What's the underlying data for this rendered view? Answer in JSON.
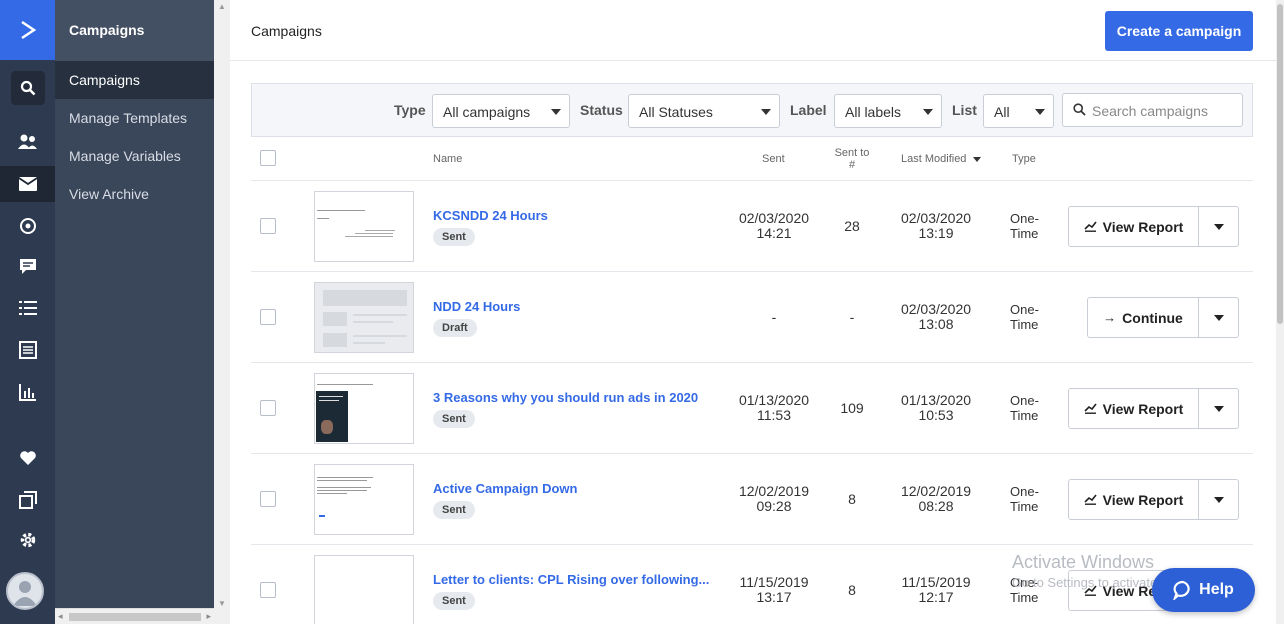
{
  "colors": {
    "accent": "#356ae6",
    "rail": "#2d3a50",
    "subnav": "#3a4659"
  },
  "sidebar": {
    "icons": [
      "logo-chevron-icon",
      "search-icon",
      "contacts-icon",
      "campaigns-envelope-icon",
      "automations-icon",
      "conversations-icon",
      "lists-icon",
      "forms-icon",
      "reports-icon",
      "apps-heart-icon",
      "pages-icon",
      "settings-gear-icon",
      "user-avatar"
    ]
  },
  "subnav": {
    "title": "Campaigns",
    "items": [
      {
        "label": "Campaigns"
      },
      {
        "label": "Manage Templates"
      },
      {
        "label": "Manage Variables"
      },
      {
        "label": "View Archive"
      }
    ]
  },
  "header": {
    "title": "Campaigns",
    "create_button": "Create a campaign"
  },
  "filters": {
    "type_label": "Type",
    "type_value": "All campaigns",
    "status_label": "Status",
    "status_value": "All Statuses",
    "label_label": "Label",
    "label_value": "All labels",
    "list_label": "List",
    "list_value": "All",
    "search_placeholder": "Search campaigns"
  },
  "table": {
    "columns": {
      "name": "Name",
      "sent": "Sent",
      "sent_to_1": "Sent to",
      "sent_to_2": "#",
      "last_modified": "Last Modified",
      "type": "Type"
    },
    "rows": [
      {
        "name": "KCSNDD 24 Hours",
        "status": "Sent",
        "sent_date": "02/03/2020",
        "sent_time": "14:21",
        "sent_to": "28",
        "mod_date": "02/03/2020",
        "mod_time": "13:19",
        "type_1": "One-",
        "type_2": "Time",
        "action": "View Report"
      },
      {
        "name": "NDD 24 Hours",
        "status": "Draft",
        "sent_date": "-",
        "sent_time": "",
        "sent_to": "-",
        "mod_date": "02/03/2020",
        "mod_time": "13:08",
        "type_1": "One-",
        "type_2": "Time",
        "action": "Continue"
      },
      {
        "name": "3 Reasons why you should run ads in 2020",
        "status": "Sent",
        "sent_date": "01/13/2020",
        "sent_time": "11:53",
        "sent_to": "109",
        "mod_date": "01/13/2020",
        "mod_time": "10:53",
        "type_1": "One-",
        "type_2": "Time",
        "action": "View Report"
      },
      {
        "name": "Active Campaign Down",
        "status": "Sent",
        "sent_date": "12/02/2019",
        "sent_time": "09:28",
        "sent_to": "8",
        "mod_date": "12/02/2019",
        "mod_time": "08:28",
        "type_1": "One-",
        "type_2": "Time",
        "action": "View Report"
      },
      {
        "name": "Letter to clients: CPL Rising over following...",
        "status": "Sent",
        "sent_date": "11/15/2019",
        "sent_time": "13:17",
        "sent_to": "8",
        "mod_date": "11/15/2019",
        "mod_time": "12:17",
        "type_1": "One-",
        "type_2": "Time",
        "action": "View Report"
      }
    ]
  },
  "watermark": {
    "line1": "Activate Windows",
    "line2": "Go to Settings to activate Windows."
  },
  "help": {
    "label": "Help"
  }
}
